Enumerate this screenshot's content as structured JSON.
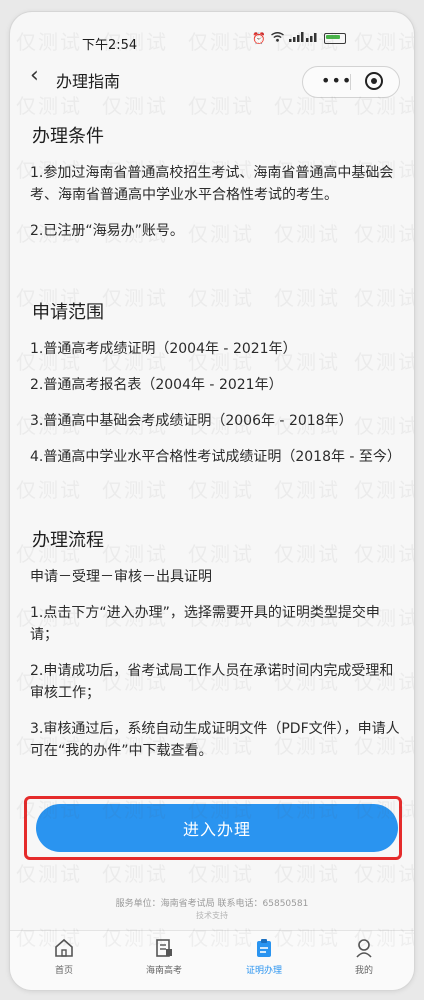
{
  "status": {
    "time": "下午2:54",
    "icons": [
      "alarm-icon",
      "wifi-icon",
      "signal-icon",
      "battery-icon"
    ]
  },
  "nav": {
    "title": "办理指南",
    "back_icon": "back-arrow-icon",
    "more_icon": "more-dots-icon",
    "close_icon": "target-icon"
  },
  "sections": [
    {
      "title": "办理条件",
      "paragraphs": [
        "1.参加过海南省普通高校招生考试、海南省普通高中基础会考、海南省普通高中学业水平合格性考试的考生。",
        "2.已注册“海易办”账号。"
      ]
    },
    {
      "title": "申请范围",
      "paragraphs": [
        "1.普通高考成绩证明（2004年 - 2021年）",
        "2.普通高考报名表（2004年 - 2021年）",
        "3.普通高中基础会考成绩证明（2006年 - 2018年）",
        "4.普通高中学业水平合格性考试成绩证明（2018年 - 至今）"
      ]
    },
    {
      "title": "办理流程",
      "paragraphs": [
        "申请－受理－审核－出具证明",
        "1.点击下方“进入办理”，选择需要开具的证明类型提交申请；",
        "2.申请成功后，省考试局工作人员在承诺时间内完成受理和审核工作；",
        "3.审核通过后，系统自动生成证明文件（PDF文件），申请人可在“我的办件”中下载查看。"
      ]
    }
  ],
  "cta": {
    "label": "进入办理"
  },
  "footer": {
    "note": "服务单位：海南省考试局  联系电话：65850581",
    "sub": "技术支持"
  },
  "tabs": [
    {
      "label": "首页",
      "icon": "home-icon",
      "active": false
    },
    {
      "label": "海南高考",
      "icon": "document-icon",
      "active": false
    },
    {
      "label": "证明办理",
      "icon": "clipboard-icon",
      "active": true
    },
    {
      "label": "我的",
      "icon": "user-icon",
      "active": false
    }
  ],
  "watermark": "仅测试",
  "colors": {
    "accent": "#2a94f0",
    "highlight": "#bfe1f7",
    "annotation_red": "#e52b2b"
  }
}
